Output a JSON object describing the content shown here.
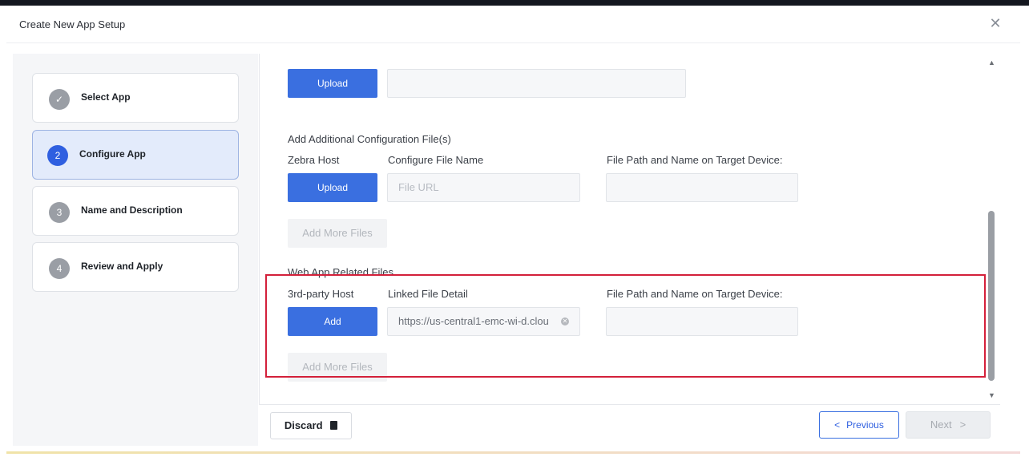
{
  "dialog": {
    "title": "Create New App Setup",
    "close_icon": "close-icon"
  },
  "steps": [
    {
      "label": "Select App",
      "marker": "✓",
      "state": "complete"
    },
    {
      "label": "Configure App",
      "marker": "2",
      "state": "active"
    },
    {
      "label": "Name and Description",
      "marker": "3",
      "state": "pending"
    },
    {
      "label": "Review and Apply",
      "marker": "4",
      "state": "pending"
    }
  ],
  "form": {
    "top_upload": {
      "button_label": "Upload",
      "field_value": ""
    },
    "additional_config": {
      "section_title": "Add Additional Configuration File(s)",
      "host_label": "Zebra Host",
      "file_name_label": "Configure File Name",
      "target_label": "File Path and Name on Target Device:",
      "upload_label": "Upload",
      "file_url_placeholder": "File URL",
      "target_value": "",
      "add_more_label": "Add More Files"
    },
    "web_app": {
      "section_title": "Web App Related Files",
      "host_label": "3rd-party Host",
      "file_detail_label": "Linked File Detail",
      "target_label": "File Path and Name on Target Device:",
      "add_label": "Add",
      "linked_value": "https://us-central1-emc-wi-d.clou",
      "target_value": "",
      "add_more_label": "Add More Files"
    }
  },
  "footer": {
    "discard_label": "Discard",
    "previous_label": "Previous",
    "next_label": "Next"
  },
  "colors": {
    "primary": "#3a6fe0",
    "highlight_border": "#d3203a"
  }
}
